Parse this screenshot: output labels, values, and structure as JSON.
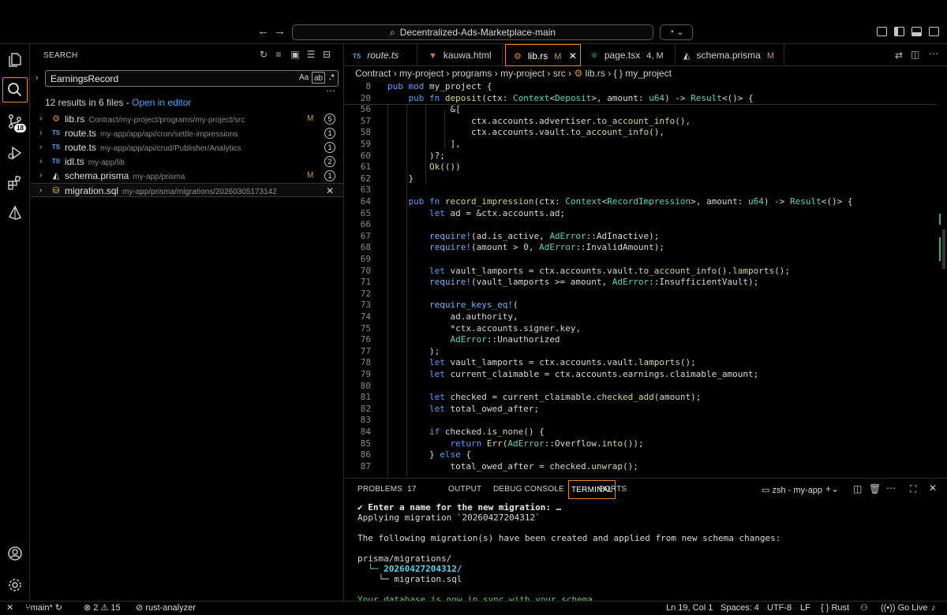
{
  "window": {
    "command_center": "Decentralized-Ads-Marketplace-main",
    "back_icon": "arrow-left-icon",
    "forward_icon": "arrow-right-icon"
  },
  "activity_bar": {
    "scm_badge": "18"
  },
  "sidebar": {
    "title": "SEARCH",
    "search_value": "EarningsRecord",
    "option_case": "Aa",
    "option_word": "ab",
    "option_regex": ".*",
    "summary_text": "12 results in 6 files - ",
    "summary_link": "Open in editor",
    "files": [
      {
        "icon": "rs",
        "name": "lib.rs",
        "path": "Contract/my-project/programs/my-project/src",
        "modified": "M",
        "count": "5"
      },
      {
        "icon": "TS",
        "name": "route.ts",
        "path": "my-app/app/api/cron/settle-impressions",
        "modified": "",
        "count": "1"
      },
      {
        "icon": "TS",
        "name": "route.ts",
        "path": "my-app/app/api/crud/Publisher/Analytics",
        "modified": "",
        "count": "1"
      },
      {
        "icon": "TS",
        "name": "idl.ts",
        "path": "my-app/lib",
        "modified": "",
        "count": "2"
      },
      {
        "icon": "prisma",
        "name": "schema.prisma",
        "path": "my-app/prisma",
        "modified": "M",
        "count": "1"
      },
      {
        "icon": "sql",
        "name": "migration.sql",
        "path": "my-app/prisma/migrations/20260305173142",
        "modified": "",
        "count": ""
      }
    ]
  },
  "tabs": [
    {
      "icon": "TS",
      "label": "route.ts",
      "suffix": ""
    },
    {
      "icon": "html",
      "label": "kauwa.html",
      "suffix": ""
    },
    {
      "icon": "rs",
      "label": "lib.rs",
      "suffix": "M"
    },
    {
      "icon": "react",
      "label": "page.tsx",
      "suffix": "4, M"
    },
    {
      "icon": "prisma",
      "label": "schema.prisma",
      "suffix": "M"
    }
  ],
  "breadcrumb": {
    "parts": [
      "Contract",
      "my-project",
      "programs",
      "my-project",
      "src"
    ],
    "file": "lib.rs",
    "symbol": "{ } my_project"
  },
  "code": {
    "line_numbers": [
      "8",
      "20",
      "56",
      "57",
      "58",
      "59",
      "60",
      "61",
      "62",
      "63",
      "64",
      "65",
      "66",
      "67",
      "68",
      "69",
      "70",
      "71",
      "72",
      "73",
      "74",
      "75",
      "76",
      "77",
      "78",
      "79",
      "80",
      "81",
      "82",
      "83",
      "84",
      "85",
      "86",
      "87"
    ],
    "lines": [
      "pub mod my_project {",
      "    pub fn deposit(ctx: Context<Deposit>, amount: u64) -> Result<()> {",
      "            &[",
      "                ctx.accounts.advertiser.to_account_info(),",
      "                ctx.accounts.vault.to_account_info(),",
      "            ],",
      "        )?;",
      "        Ok(())",
      "    }",
      "",
      "    pub fn record_impression(ctx: Context<RecordImpression>, amount: u64) -> Result<()> {",
      "        let ad = &ctx.accounts.ad;",
      "",
      "        require!(ad.is_active, AdError::AdInactive);",
      "        require!(amount > 0, AdError::InvalidAmount);",
      "",
      "        let vault_lamports = ctx.accounts.vault.to_account_info().lamports();",
      "        require!(vault_lamports >= amount, AdError::InsufficientVault);",
      "",
      "        require_keys_eq!(",
      "            ad.authority,",
      "            *ctx.accounts.signer.key,",
      "            AdError::Unauthorized",
      "        );",
      "        let vault_lamports = ctx.accounts.vault.lamports();",
      "        let current_claimable = ctx.accounts.earnings.claimable_amount;",
      "",
      "        let checked = current_claimable.checked_add(amount);",
      "        let total_owed_after;",
      "",
      "        if checked.is_none() {",
      "            return Err(AdError::Overflow.into());",
      "        } else {",
      "            total_owed_after = checked.unwrap();"
    ]
  },
  "panel": {
    "tabs": [
      "PROBLEMS",
      "OUTPUT",
      "DEBUG CONSOLE",
      "TERMINAL",
      "PORTS"
    ],
    "problems_count": "17",
    "terminal_name": "zsh - my-app",
    "terminal_lines": [
      "✔ Enter a name for the new migration: …",
      "Applying migration `20260427204312`",
      "",
      "The following migration(s) have been created and applied from new schema changes:",
      "",
      "prisma/migrations/",
      "  └─ 20260427204312/",
      "    └─ migration.sql",
      "",
      "Your database is now in sync with your schema."
    ]
  },
  "status": {
    "branch": "main*",
    "errors": "2",
    "warnings": "15",
    "analyzer": "rust-analyzer",
    "position": "Ln 19, Col 1",
    "spaces": "Spaces: 4",
    "encoding": "UTF-8",
    "eol": "LF",
    "language": "Rust",
    "golive": "Go Live"
  }
}
